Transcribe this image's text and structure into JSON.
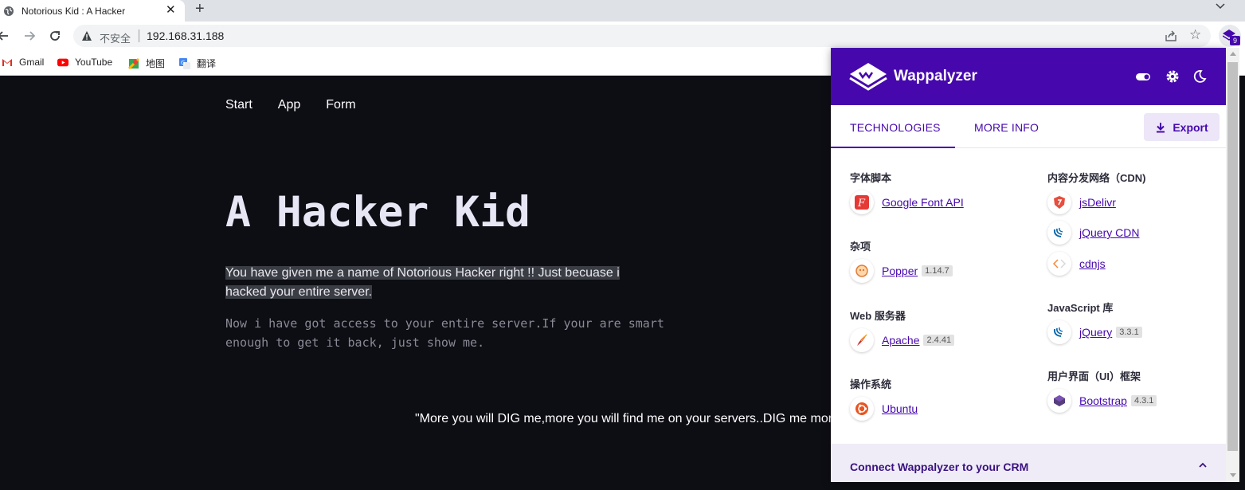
{
  "browser": {
    "tab_title": "Notorious Kid : A Hacker",
    "tab_close": "✕",
    "new_tab": "+",
    "security_label": "不安全",
    "url": "192.168.31.188",
    "extension_badge": "9",
    "bookmarks": [
      {
        "label": "Gmail",
        "icon": "gmail-icon"
      },
      {
        "label": "YouTube",
        "icon": "youtube-icon"
      },
      {
        "label": "地图",
        "icon": "maps-icon"
      },
      {
        "label": "翻译",
        "icon": "translate-icon"
      }
    ]
  },
  "page": {
    "nav": [
      "Start",
      "App",
      "Form"
    ],
    "title": "A Hacker Kid",
    "subtitle": "You have given me a name of Notorious Hacker right !! Just becuase i hacked your entire server.",
    "body": "Now i have got access to your entire server.If your are smart enough to get it back, just show me.",
    "quote": "\"More you will DIG me,more you will find me on your servers..DIG me more"
  },
  "wappalyzer": {
    "brand": "Wappalyzer",
    "tabs": {
      "technologies": "TECHNOLOGIES",
      "more_info": "MORE INFO"
    },
    "export_label": "Export",
    "categories_left": [
      {
        "name": "字体脚本",
        "techs": [
          {
            "name": "Google Font API",
            "version": "",
            "icon": "google-font-icon"
          }
        ]
      },
      {
        "name": "杂项",
        "techs": [
          {
            "name": "Popper",
            "version": "1.14.7",
            "icon": "popper-icon"
          }
        ]
      },
      {
        "name": "Web 服务器",
        "techs": [
          {
            "name": "Apache",
            "version": "2.4.41",
            "icon": "apache-icon"
          }
        ]
      },
      {
        "name": "操作系统",
        "techs": [
          {
            "name": "Ubuntu",
            "version": "",
            "icon": "ubuntu-icon"
          }
        ]
      }
    ],
    "categories_right": [
      {
        "name": "内容分发网络（CDN)",
        "techs": [
          {
            "name": "jsDelivr",
            "version": "",
            "icon": "jsdelivr-icon"
          },
          {
            "name": "jQuery CDN",
            "version": "",
            "icon": "jquery-cdn-icon"
          },
          {
            "name": "cdnjs",
            "version": "",
            "icon": "cdnjs-icon"
          }
        ]
      },
      {
        "name": "JavaScript 库",
        "techs": [
          {
            "name": "jQuery",
            "version": "3.3.1",
            "icon": "jquery-icon"
          }
        ]
      },
      {
        "name": "用户界面（UI）框架",
        "techs": [
          {
            "name": "Bootstrap",
            "version": "4.3.1",
            "icon": "bootstrap-icon"
          }
        ]
      }
    ],
    "crm_label": "Connect Wappalyzer to your CRM",
    "accent_color": "#4608ad"
  }
}
